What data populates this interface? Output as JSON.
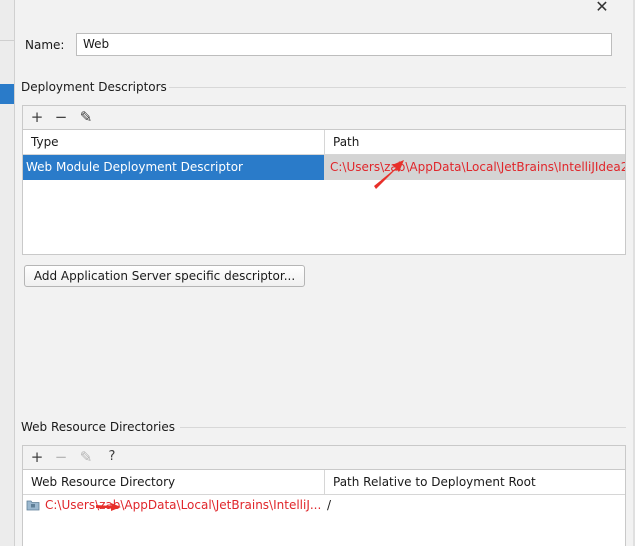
{
  "window": {
    "close_glyph": "✕"
  },
  "name_field": {
    "label": "Name:",
    "value": "Web"
  },
  "deployment_descriptors": {
    "title": "Deployment Descriptors",
    "toolbar": {
      "add": "+",
      "remove": "−",
      "edit": "✎"
    },
    "columns": [
      "Type",
      "Path"
    ],
    "rows": [
      {
        "type": "Web Module Deployment Descriptor",
        "path": "C:\\Users\\zab\\AppData\\Local\\JetBrains\\IntelliJIdea2"
      }
    ],
    "add_server_button": "Add Application Server specific descriptor..."
  },
  "web_resource_directories": {
    "title": "Web Resource Directories",
    "toolbar": {
      "add": "+",
      "remove": "−",
      "edit": "✎",
      "help": "?"
    },
    "columns": [
      "Web Resource Directory",
      "Path Relative to Deployment Root"
    ],
    "rows": [
      {
        "directory": "C:\\Users\\zab\\AppData\\Local\\JetBrains\\IntelliJ...",
        "relative_path": "/"
      }
    ]
  },
  "colors": {
    "selection": "#2a7bc9",
    "error_text": "#e0262b",
    "annotation_arrow": "#e8302a"
  },
  "icons": [
    "close-icon",
    "plus-icon",
    "minus-icon",
    "pencil-icon",
    "question-icon",
    "folder-icon"
  ]
}
